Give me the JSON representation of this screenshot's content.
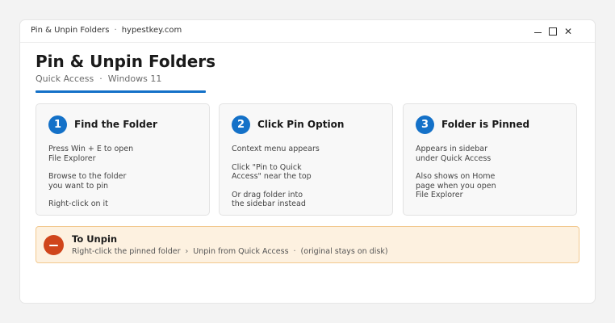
{
  "window": {
    "title_main": "Pin & Unpin Folders",
    "title_separator": "·",
    "title_site": "hypestkey.com",
    "controls": {
      "minimize": "—",
      "maximize": "☐",
      "close": "✕"
    }
  },
  "header": {
    "title": "Pin & Unpin Folders",
    "subtitle_left": "Quick Access",
    "subtitle_separator": "·",
    "subtitle_right": "Windows 11",
    "accent_color": "#1471c8"
  },
  "steps": [
    {
      "number": "1",
      "title": "Find the Folder",
      "lines": [
        "Press  Win + E  to open\nFile Explorer",
        "Browse to the folder\nyou want to pin",
        "Right-click on it"
      ]
    },
    {
      "number": "2",
      "title": "Click Pin Option",
      "lines": [
        "Context menu appears",
        "Click \"Pin to Quick\nAccess\" near the top",
        "Or drag folder into\nthe sidebar instead"
      ]
    },
    {
      "number": "3",
      "title": "Folder is Pinned",
      "lines": [
        "Appears in sidebar\nunder Quick Access",
        "Also shows on Home\npage when you open\nFile Explorer"
      ]
    }
  ],
  "unpin": {
    "icon": "minus-circle-icon",
    "title": "To Unpin",
    "step1": "Right-click the pinned folder",
    "arrow": "›",
    "step2": "Unpin from Quick Access",
    "separator": "·",
    "note": "(original stays on disk)",
    "icon_color": "#d0451b",
    "background_color": "#fdf1e0"
  }
}
